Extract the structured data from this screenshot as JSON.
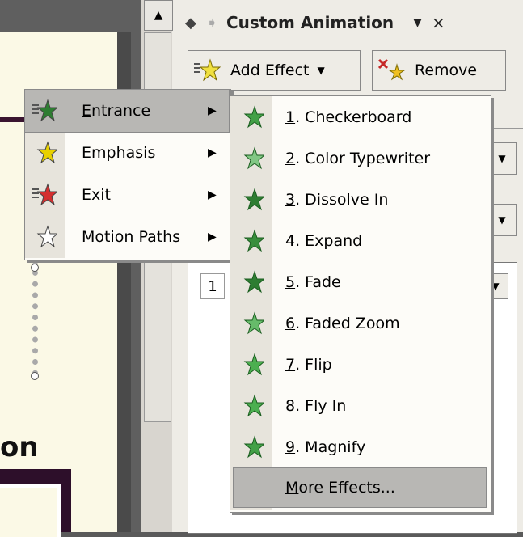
{
  "task_pane": {
    "title": "Custom Animation",
    "add_effect_label": "Add Effect",
    "remove_label": "Remove",
    "list_item_number": "1"
  },
  "slide": {
    "visible_text": "on"
  },
  "entrance_menu": {
    "items": [
      {
        "label_pre": "",
        "label_key": "E",
        "label_post": "ntrance",
        "icon": "entrance-star-icon",
        "color": "#2e7d32",
        "has_submenu": true,
        "highlighted": true
      },
      {
        "label_pre": "E",
        "label_key": "m",
        "label_post": "phasis",
        "icon": "emphasis-star-icon",
        "color": "#e8d100",
        "has_submenu": true,
        "highlighted": false
      },
      {
        "label_pre": "E",
        "label_key": "x",
        "label_post": "it",
        "icon": "exit-star-icon",
        "color": "#d32f2f",
        "has_submenu": true,
        "highlighted": false
      },
      {
        "label_pre": "Motion ",
        "label_key": "P",
        "label_post": "aths",
        "icon": "motion-path-star-icon",
        "color": "#ffffff",
        "has_submenu": true,
        "highlighted": false
      }
    ]
  },
  "effects_menu": {
    "items": [
      {
        "key": "1",
        "rest": ". Checkerboard"
      },
      {
        "key": "2",
        "rest": ". Color Typewriter"
      },
      {
        "key": "3",
        "rest": ". Dissolve In"
      },
      {
        "key": "4",
        "rest": ". Expand"
      },
      {
        "key": "5",
        "rest": ". Fade"
      },
      {
        "key": "6",
        "rest": ". Faded Zoom"
      },
      {
        "key": "7",
        "rest": ". Flip"
      },
      {
        "key": "8",
        "rest": ". Fly In"
      },
      {
        "key": "9",
        "rest": ". Magnify"
      }
    ],
    "more_key": "M",
    "more_rest": "ore Effects..."
  }
}
